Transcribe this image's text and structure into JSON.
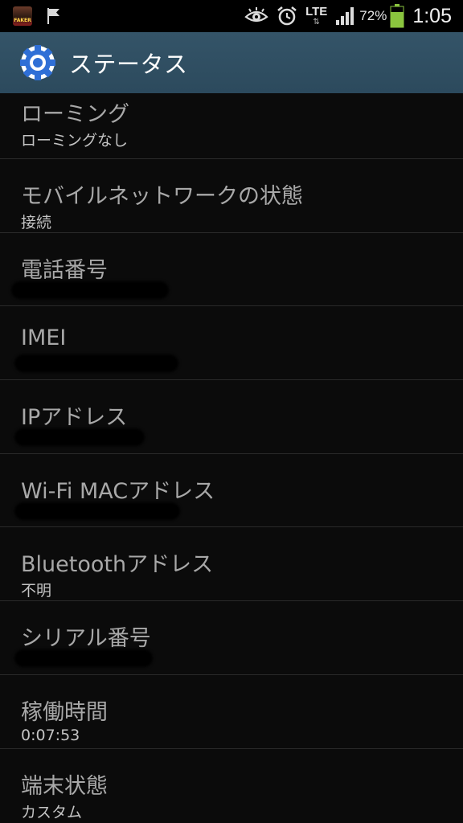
{
  "status_bar": {
    "app_notification_label": "FAKER",
    "network_type": "LTE",
    "data_arrows": "⇅",
    "battery_percent": "72%",
    "time": "1:05"
  },
  "action_bar": {
    "title": "ステータス",
    "icon": "settings-gear-icon"
  },
  "items": [
    {
      "title": "ローミング",
      "value": "ローミングなし"
    },
    {
      "title": "モバイルネットワークの状態",
      "value": "接続"
    },
    {
      "title": "電話番号",
      "value": ""
    },
    {
      "title": "IMEI",
      "value": ""
    },
    {
      "title": "IPアドレス",
      "value": ""
    },
    {
      "title": "Wi-Fi MACアドレス",
      "value": ""
    },
    {
      "title": "Bluetoothアドレス",
      "value": "不明"
    },
    {
      "title": "シリアル番号",
      "value": ""
    },
    {
      "title": "稼働時間",
      "value": "0:07:53"
    },
    {
      "title": "端末状態",
      "value": "カスタム"
    }
  ],
  "colors": {
    "action_bar_bg": "#2f4e62",
    "gear_blue": "#2f6fd6",
    "battery_green": "#8ac53e",
    "list_bg": "#0b0b0b",
    "title_text": "#a8a8a8",
    "divider": "#2a2a2a"
  }
}
